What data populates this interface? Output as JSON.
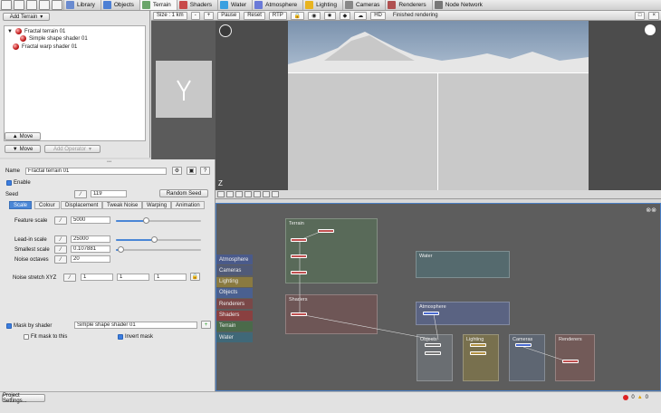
{
  "toolbar": {
    "tabs": [
      {
        "label": "Library",
        "icon": "library-icon",
        "color": "#6a8bd0"
      },
      {
        "label": "Objects",
        "icon": "objects-icon",
        "color": "#4c7fd4"
      },
      {
        "label": "Terrain",
        "icon": "terrain-icon",
        "color": "#6aa56a"
      },
      {
        "label": "Shaders",
        "icon": "shaders-icon",
        "color": "#c84a4a"
      },
      {
        "label": "Water",
        "icon": "water-icon",
        "color": "#3aa0e0"
      },
      {
        "label": "Atmosphere",
        "icon": "atmosphere-icon",
        "color": "#6a7ad8"
      },
      {
        "label": "Lighting",
        "icon": "lighting-icon",
        "color": "#e8b420"
      },
      {
        "label": "Cameras",
        "icon": "cameras-icon",
        "color": "#888888"
      },
      {
        "label": "Renderers",
        "icon": "renderers-icon",
        "color": "#b05050"
      },
      {
        "label": "Node Network",
        "icon": "node-network-icon",
        "color": "#777777"
      }
    ],
    "active_tab": "Terrain"
  },
  "left_panel": {
    "add_terrain_label": "Add Terrain",
    "tree": [
      {
        "label": "Fractal terrain 01",
        "level": 0
      },
      {
        "label": "Simple shape shader 01",
        "level": 1
      },
      {
        "label": "Fractal warp shader 01",
        "level": 0
      }
    ],
    "move_up_label": "Move",
    "move_down_label": "Move",
    "add_operator_label": "Add Operator"
  },
  "viewport": {
    "size_label": "Size : 1 km",
    "minus_label": "-",
    "plus_label": "+",
    "pause_label": "Pause",
    "reset_label": "Reset",
    "rtp_label": "RTP",
    "hd_label": "HD",
    "status_text": "Finished rendering"
  },
  "properties": {
    "name_label": "Name",
    "name_value": "Fractal terrain 01",
    "enable_label": "Enable",
    "seed_label": "Seed",
    "seed_value": "119",
    "random_seed_label": "Random Seed",
    "tabs": [
      "Scale",
      "Colour",
      "Displacement",
      "Tweak Noise",
      "Warping",
      "Animation"
    ],
    "active_tab": "Scale",
    "params": [
      {
        "label": "Feature scale",
        "value": "5000",
        "slider": 0.35
      },
      {
        "label": "Lead-in scale",
        "value": "25000",
        "slider": 0.45
      },
      {
        "label": "Smallest scale",
        "value": "0.107881",
        "slider": 0.05
      },
      {
        "label": "Noise octaves",
        "value": "20"
      }
    ],
    "noise_stretch_label": "Noise stretch XYZ",
    "noise_stretch": [
      "1",
      "1",
      "1"
    ],
    "mask_by_shader_label": "Mask by shader",
    "mask_shader_value": "Simple shape shader 01",
    "fit_mask_label": "Fit mask to this",
    "invert_mask_label": "Invert mask"
  },
  "node_network": {
    "categories": [
      {
        "label": "Atmosphere",
        "color": "#4a5a8a"
      },
      {
        "label": "Cameras",
        "color": "#505a78"
      },
      {
        "label": "Lighting",
        "color": "#8a7a40"
      },
      {
        "label": "Objects",
        "color": "#4a6090"
      },
      {
        "label": "Renderers",
        "color": "#7a4848"
      },
      {
        "label": "Shaders",
        "color": "#8a4040"
      },
      {
        "label": "Terrain",
        "color": "#4a6a4a"
      },
      {
        "label": "Water",
        "color": "#406878"
      }
    ],
    "groups": [
      "Terrain",
      "Water",
      "Shaders",
      "Atmosphere",
      "Objects",
      "Lighting",
      "Cameras",
      "Renderers"
    ]
  },
  "status": {
    "project_settings_label": "Project Settings...",
    "errors": "0",
    "warnings": "0"
  }
}
